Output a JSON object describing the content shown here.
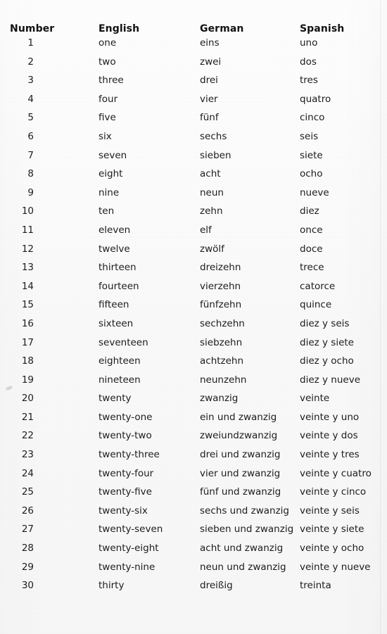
{
  "table": {
    "columns": [
      {
        "key": "number",
        "label": "Number"
      },
      {
        "key": "english",
        "label": "English"
      },
      {
        "key": "german",
        "label": "German"
      },
      {
        "key": "spanish",
        "label": "Spanish"
      }
    ],
    "rows": [
      {
        "number": "1",
        "english": "one",
        "german": "eins",
        "spanish": "uno"
      },
      {
        "number": "2",
        "english": "two",
        "german": "zwei",
        "spanish": "dos"
      },
      {
        "number": "3",
        "english": "three",
        "german": "drei",
        "spanish": "tres"
      },
      {
        "number": "4",
        "english": "four",
        "german": "vier",
        "spanish": "quatro"
      },
      {
        "number": "5",
        "english": "five",
        "german": "fünf",
        "spanish": "cinco"
      },
      {
        "number": "6",
        "english": "six",
        "german": "sechs",
        "spanish": "seis"
      },
      {
        "number": "7",
        "english": "seven",
        "german": "sieben",
        "spanish": "siete"
      },
      {
        "number": "8",
        "english": "eight",
        "german": "acht",
        "spanish": "ocho"
      },
      {
        "number": "9",
        "english": "nine",
        "german": "neun",
        "spanish": "nueve"
      },
      {
        "number": "10",
        "english": "ten",
        "german": "zehn",
        "spanish": "diez"
      },
      {
        "number": "11",
        "english": "eleven",
        "german": "elf",
        "spanish": "once"
      },
      {
        "number": "12",
        "english": "twelve",
        "german": "zwölf",
        "spanish": "doce"
      },
      {
        "number": "13",
        "english": "thirteen",
        "german": "dreizehn",
        "spanish": "trece"
      },
      {
        "number": "14",
        "english": "fourteen",
        "german": "vierzehn",
        "spanish": "catorce"
      },
      {
        "number": "15",
        "english": "fifteen",
        "german": "fünfzehn",
        "spanish": "quince"
      },
      {
        "number": "16",
        "english": "sixteen",
        "german": "sechzehn",
        "spanish": "diez y seis"
      },
      {
        "number": "17",
        "english": "seventeen",
        "german": "siebzehn",
        "spanish": "diez y siete"
      },
      {
        "number": "18",
        "english": "eighteen",
        "german": "achtzehn",
        "spanish": "diez y ocho"
      },
      {
        "number": "19",
        "english": "nineteen",
        "german": "neunzehn",
        "spanish": "diez y nueve"
      },
      {
        "number": "20",
        "english": "twenty",
        "german": "zwanzig",
        "spanish": "veinte"
      },
      {
        "number": "21",
        "english": "twenty-one",
        "german": "ein und zwanzig",
        "spanish": "veinte y uno"
      },
      {
        "number": "22",
        "english": "twenty-two",
        "german": "zweiundzwanzig",
        "spanish": "veinte y dos"
      },
      {
        "number": "23",
        "english": "twenty-three",
        "german": "drei und zwanzig",
        "spanish": "veinte y tres"
      },
      {
        "number": "24",
        "english": "twenty-four",
        "german": "vier und zwanzig",
        "spanish": "veinte y cuatro"
      },
      {
        "number": "25",
        "english": "twenty-five",
        "german": "fünf und zwanzig",
        "spanish": "veinte y cinco"
      },
      {
        "number": "26",
        "english": "twenty-six",
        "german": "sechs und zwanzig",
        "spanish": "veinte y seis"
      },
      {
        "number": "27",
        "english": "twenty-seven",
        "german": "sieben und zwanzig",
        "spanish": "veinte y siete"
      },
      {
        "number": "28",
        "english": "twenty-eight",
        "german": "acht und zwanzig",
        "spanish": "veinte y ocho"
      },
      {
        "number": "29",
        "english": "twenty-nine",
        "german": "neun und zwanzig",
        "spanish": "veinte y nueve"
      },
      {
        "number": "30",
        "english": "thirty",
        "german": "dreißig",
        "spanish": "treinta"
      }
    ]
  }
}
